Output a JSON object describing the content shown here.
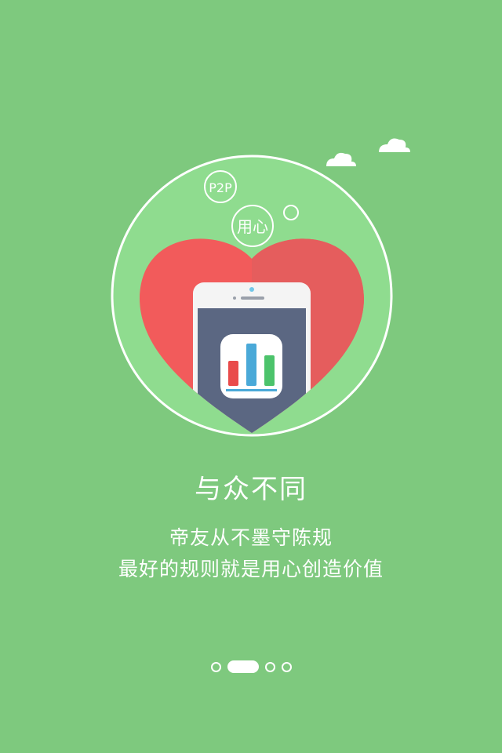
{
  "onboarding": {
    "title": "与众不同",
    "subtitle_line1": "帝友从不墨守陈规",
    "subtitle_line2": "最好的规则就是用心创造价值",
    "badge_p2p": "P2P",
    "badge_heart": "用心",
    "page_count": 4,
    "current_page_index": 1
  },
  "colors": {
    "background": "#7ec97e",
    "circle_fill": "#8fdc8f",
    "heart_left": "#f25b5b",
    "heart_right": "#e55d5d",
    "phone_screen": "#5b6782",
    "bar_red": "#e94b4b",
    "bar_blue": "#4aa9d8",
    "bar_green": "#4cc36b"
  },
  "icons": {
    "cloud_small": "cloud-icon",
    "cloud_large": "cloud-icon",
    "app_icon": "bar-chart-app-icon"
  }
}
